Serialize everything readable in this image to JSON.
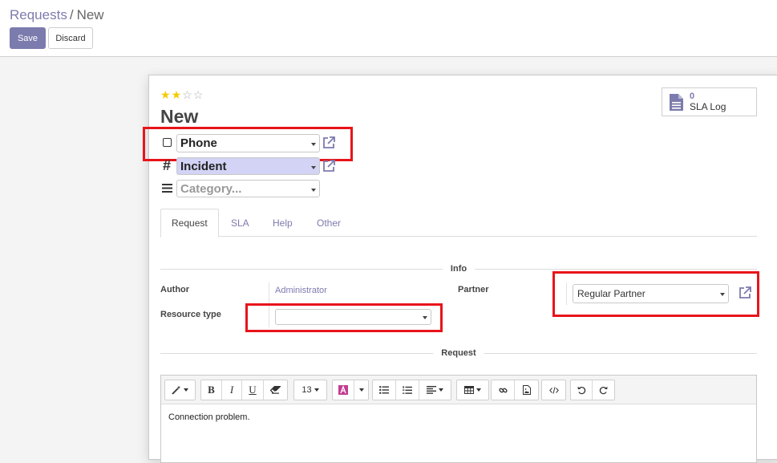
{
  "breadcrumb": {
    "parent": "Requests",
    "separator": "/",
    "current": "New"
  },
  "buttons": {
    "save": "Save",
    "discard": "Discard"
  },
  "record": {
    "stars": {
      "filled": 2,
      "total": 4,
      "filled_char": "★",
      "empty_char": "☆"
    },
    "title": "New",
    "channel": "Phone",
    "type": "Incident",
    "category_placeholder": "Category..."
  },
  "stat_button": {
    "count": "0",
    "label": "SLA Log"
  },
  "tabs": [
    {
      "label": "Request",
      "active": true
    },
    {
      "label": "SLA",
      "active": false
    },
    {
      "label": "Help",
      "active": false
    },
    {
      "label": "Other",
      "active": false
    }
  ],
  "info": {
    "separator_label": "Info",
    "author_label": "Author",
    "author_value": "Administrator",
    "resource_type_label": "Resource type",
    "resource_type_value": "",
    "partner_label": "Partner",
    "partner_value": "Regular Partner"
  },
  "request": {
    "separator_label": "Request",
    "font_size": "13",
    "content": "Connection problem."
  },
  "colors": {
    "accent": "#7c7bad",
    "highlight": "#d2d3f5",
    "annotation_red": "#e8141a",
    "star": "#f3cc00"
  }
}
